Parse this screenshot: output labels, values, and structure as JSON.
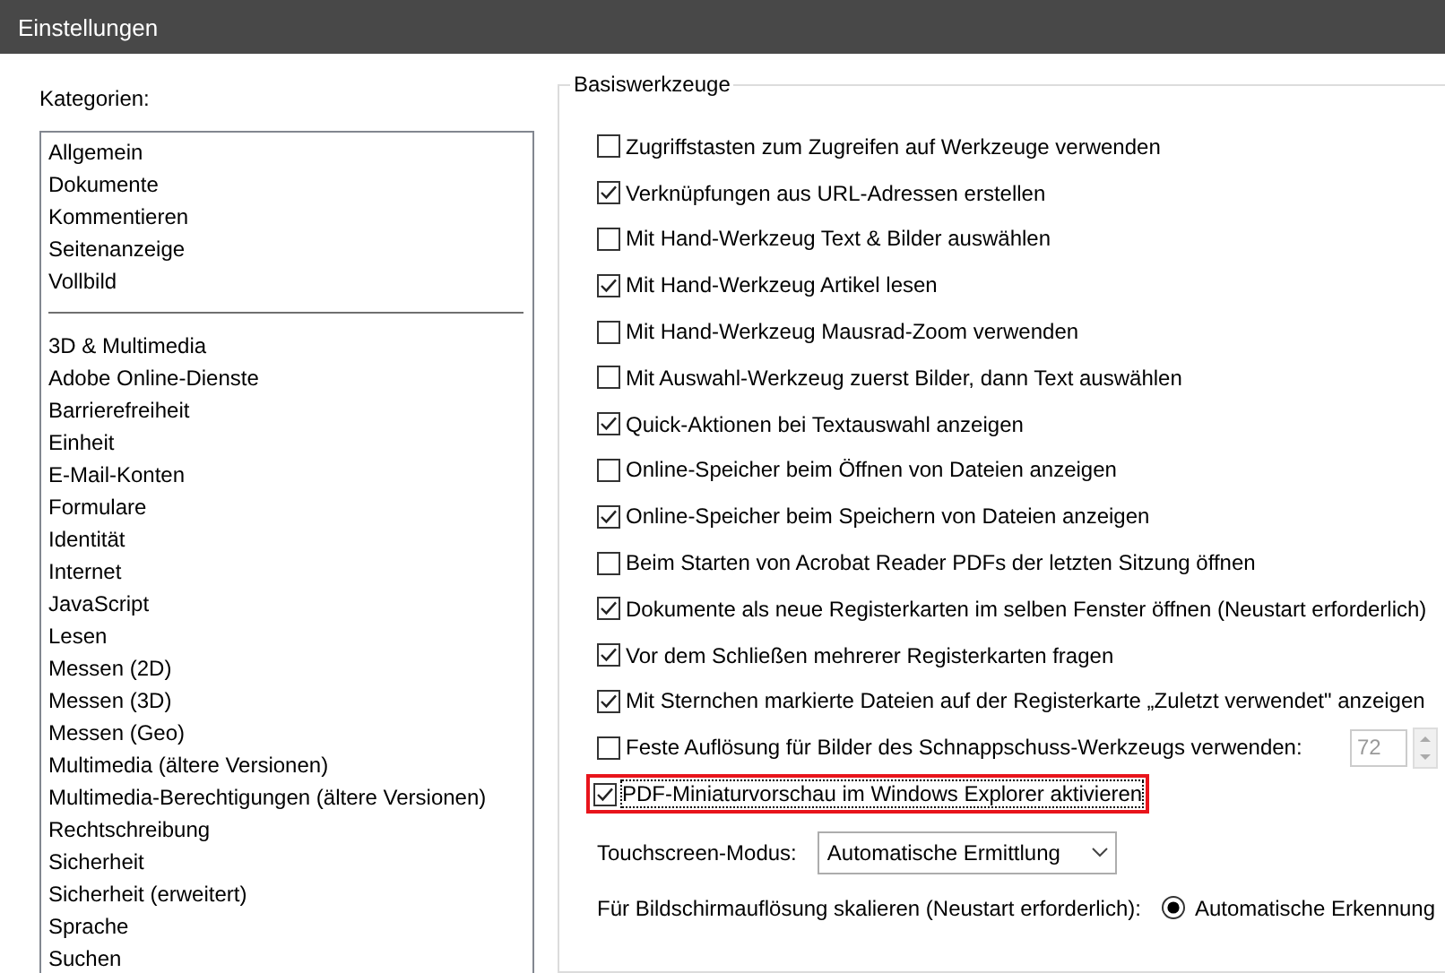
{
  "window": {
    "title": "Einstellungen"
  },
  "categories": {
    "label": "Kategorien:",
    "groups": [
      {
        "items": [
          {
            "label": "Allgemein",
            "selected": false
          },
          {
            "label": "Dokumente",
            "selected": false
          },
          {
            "label": "Kommentieren",
            "selected": false
          },
          {
            "label": "Seitenanzeige",
            "selected": false
          },
          {
            "label": "Vollbild",
            "selected": false
          }
        ]
      },
      {
        "items": [
          {
            "label": "3D & Multimedia",
            "selected": false
          },
          {
            "label": "Adobe Online-Dienste",
            "selected": false
          },
          {
            "label": "Barrierefreiheit",
            "selected": false
          },
          {
            "label": "Einheit",
            "selected": false
          },
          {
            "label": "E-Mail-Konten",
            "selected": false
          },
          {
            "label": "Formulare",
            "selected": false
          },
          {
            "label": "Identität",
            "selected": false
          },
          {
            "label": "Internet",
            "selected": false
          },
          {
            "label": "JavaScript",
            "selected": false
          },
          {
            "label": "Lesen",
            "selected": false
          },
          {
            "label": "Messen (2D)",
            "selected": false
          },
          {
            "label": "Messen (3D)",
            "selected": false
          },
          {
            "label": "Messen (Geo)",
            "selected": false
          },
          {
            "label": "Multimedia (ältere Versionen)",
            "selected": false
          },
          {
            "label": "Multimedia-Berechtigungen (ältere Versionen)",
            "selected": false
          },
          {
            "label": "Rechtschreibung",
            "selected": false
          },
          {
            "label": "Sicherheit",
            "selected": false
          },
          {
            "label": "Sicherheit (erweitert)",
            "selected": false
          },
          {
            "label": "Sprache",
            "selected": false
          },
          {
            "label": "Suchen",
            "selected": false
          }
        ]
      }
    ]
  },
  "group": {
    "title": "Basiswerkzeuge",
    "options": [
      {
        "label": "Zugriffstasten zum Zugreifen auf Werkzeuge verwenden",
        "checked": false,
        "highlighted": false
      },
      {
        "label": "Verknüpfungen aus URL-Adressen erstellen",
        "checked": true,
        "highlighted": false
      },
      {
        "label": "Mit Hand-Werkzeug Text & Bilder auswählen",
        "checked": false,
        "highlighted": false
      },
      {
        "label": "Mit Hand-Werkzeug Artikel lesen",
        "checked": true,
        "highlighted": false
      },
      {
        "label": "Mit Hand-Werkzeug Mausrad-Zoom verwenden",
        "checked": false,
        "highlighted": false
      },
      {
        "label": "Mit Auswahl-Werkzeug zuerst Bilder, dann Text auswählen",
        "checked": false,
        "highlighted": false
      },
      {
        "label": "Quick-Aktionen bei Textauswahl anzeigen",
        "checked": true,
        "highlighted": false
      },
      {
        "label": "Online-Speicher beim Öffnen von Dateien anzeigen",
        "checked": false,
        "highlighted": false
      },
      {
        "label": "Online-Speicher beim Speichern von Dateien anzeigen",
        "checked": true,
        "highlighted": false
      },
      {
        "label": "Beim Starten von Acrobat Reader PDFs der letzten Sitzung öffnen",
        "checked": false,
        "highlighted": false
      },
      {
        "label": "Dokumente als neue Registerkarten im selben Fenster öffnen (Neustart erforderlich)",
        "checked": true,
        "highlighted": false
      },
      {
        "label": "Vor dem Schließen mehrerer Registerkarten fragen",
        "checked": true,
        "highlighted": false
      },
      {
        "label": "Mit Sternchen markierte Dateien auf der Registerkarte „Zuletzt verwendet\" anzeigen",
        "checked": true,
        "highlighted": false
      },
      {
        "label": "Feste Auflösung für Bilder des Schnappschuss-Werkzeugs verwenden:",
        "checked": false,
        "highlighted": false,
        "spin": {
          "value": "72",
          "disabled": true
        }
      },
      {
        "label": "PDF-Miniaturvorschau im Windows Explorer aktivieren",
        "checked": true,
        "highlighted": true
      }
    ],
    "touchscreen": {
      "label": "Touchscreen-Modus:",
      "value": "Automatische Ermittlung"
    },
    "scaling": {
      "label": "Für Bildschirmauflösung skalieren (Neustart erforderlich):",
      "option": "Automatische Erkennung",
      "selected": true
    }
  }
}
